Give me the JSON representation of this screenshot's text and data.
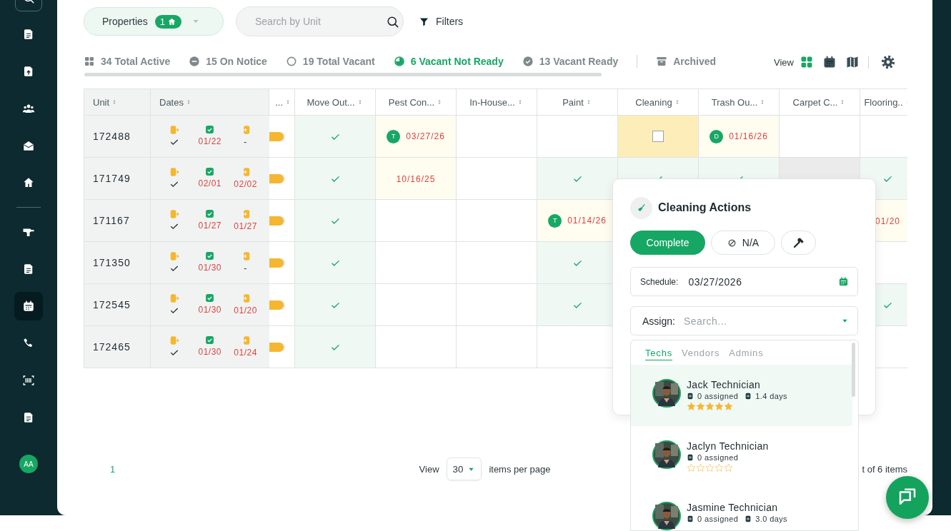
{
  "sidebar": {
    "sections": [
      {
        "items": [
          {
            "outlined": true,
            "selected": false
          },
          {
            "outlined": false,
            "selected": false
          },
          {
            "outlined": false,
            "selected": false
          },
          {
            "outlined": false,
            "selected": false
          },
          {
            "outlined": false,
            "selected": false
          },
          {
            "outlined": false,
            "selected": false
          }
        ]
      },
      {
        "items": [
          {
            "outlined": false,
            "selected": false
          },
          {
            "outlined": false,
            "selected": false
          },
          {
            "outlined": false,
            "selected": true
          },
          {
            "outlined": false,
            "selected": false
          },
          {
            "outlined": false,
            "selected": false
          },
          {
            "outlined": false,
            "selected": false
          }
        ]
      }
    ],
    "avatar": "AA"
  },
  "toolbar": {
    "properties_filter": {
      "label": "Properties",
      "count": "1"
    },
    "search": {
      "placeholder": "Search by Unit"
    },
    "filters_button": {
      "label": "Filters"
    }
  },
  "status_tabs": [
    {
      "label": "34 Total Active",
      "selected": false
    },
    {
      "label": "15 On Notice",
      "selected": false
    },
    {
      "label": "19 Total Vacant",
      "selected": false
    },
    {
      "label": "6 Vacant Not Ready",
      "selected": true
    },
    {
      "label": "13 Vacant Ready",
      "selected": false
    }
  ],
  "archive_tab": {
    "label": "Archived",
    "selected": false
  },
  "view_switch": {
    "label": "View",
    "options": [
      {
        "selected": true
      },
      {
        "selected": false
      },
      {
        "selected": false
      }
    ]
  },
  "table": {
    "columns": [
      {
        "label": "Unit"
      },
      {
        "label": "Dates"
      },
      {
        "label": "..."
      },
      {
        "label": "Move Out..."
      },
      {
        "label": "Pest Con..."
      },
      {
        "label": "In-House..."
      },
      {
        "label": "Paint"
      },
      {
        "label": "Cleaning"
      },
      {
        "label": "Trash Ou..."
      },
      {
        "label": "Carpet C..."
      },
      {
        "label": "Flooring.."
      }
    ],
    "rows": [
      {
        "cells": [
          {
            "kind": "unit",
            "text": "172488"
          },
          {
            "kind": "dates",
            "move_out_done": true,
            "due": "01/22",
            "move_in": "-"
          },
          {
            "kind": "pill"
          },
          {
            "kind": "check",
            "color": "#f0f8f4"
          },
          {
            "kind": "date",
            "badge": "T",
            "date": "03/27/26",
            "color": "#fffcf0"
          },
          {
            "kind": "empty"
          },
          {
            "kind": "empty"
          },
          {
            "kind": "checkbox",
            "checked": false,
            "color": "#fdedb9"
          },
          {
            "kind": "date",
            "badge": "D",
            "date": "01/16/26",
            "color": "#fffcf0"
          },
          {
            "kind": "empty"
          },
          {
            "kind": "empty"
          }
        ]
      },
      {
        "cells": [
          {
            "kind": "unit",
            "text": "171749"
          },
          {
            "kind": "dates",
            "move_out_done": true,
            "due": "02/01",
            "move_in": "02/02"
          },
          {
            "kind": "pill"
          },
          {
            "kind": "check",
            "color": "#f0f8f4"
          },
          {
            "kind": "date",
            "date": "10/16/25",
            "color": "#fffcf0"
          },
          {
            "kind": "empty"
          },
          {
            "kind": "check",
            "color": "#f0f8f4"
          },
          {
            "kind": "check",
            "color": "#f0f8f4"
          },
          {
            "kind": "check",
            "color": "#f0f8f4"
          },
          {
            "kind": "empty",
            "color": "#ebebeb"
          },
          {
            "kind": "check",
            "color": "#f0f8f4"
          }
        ]
      },
      {
        "cells": [
          {
            "kind": "unit",
            "text": "171167"
          },
          {
            "kind": "dates",
            "move_out_done": true,
            "due": "01/27",
            "move_in": "01/27"
          },
          {
            "kind": "pill"
          },
          {
            "kind": "check",
            "color": "#f0f8f4"
          },
          {
            "kind": "empty"
          },
          {
            "kind": "empty"
          },
          {
            "kind": "date",
            "badge": "T",
            "date": "01/14/26",
            "color": "#fffcf0"
          },
          {
            "kind": "empty"
          },
          {
            "kind": "empty"
          },
          {
            "kind": "empty"
          },
          {
            "kind": "date",
            "date": "01/20",
            "color": "#fffcf0"
          }
        ]
      },
      {
        "cells": [
          {
            "kind": "unit",
            "text": "171350"
          },
          {
            "kind": "dates",
            "move_out_done": true,
            "due": "01/30",
            "move_in": "-"
          },
          {
            "kind": "pill"
          },
          {
            "kind": "check",
            "color": "#f0f8f4"
          },
          {
            "kind": "empty"
          },
          {
            "kind": "empty"
          },
          {
            "kind": "check",
            "color": "#f0f8f4"
          },
          {
            "kind": "empty"
          },
          {
            "kind": "empty"
          },
          {
            "kind": "empty"
          },
          {
            "kind": "empty"
          }
        ]
      },
      {
        "cells": [
          {
            "kind": "unit",
            "text": "172545"
          },
          {
            "kind": "dates",
            "move_out_done": true,
            "due": "01/30",
            "move_in": "01/20"
          },
          {
            "kind": "pill"
          },
          {
            "kind": "check",
            "color": "#f0f8f4"
          },
          {
            "kind": "empty"
          },
          {
            "kind": "empty"
          },
          {
            "kind": "check",
            "color": "#f0f8f4"
          },
          {
            "kind": "empty"
          },
          {
            "kind": "empty"
          },
          {
            "kind": "empty"
          },
          {
            "kind": "check",
            "color": "#f0f8f4"
          }
        ]
      },
      {
        "cells": [
          {
            "kind": "unit",
            "text": "172465"
          },
          {
            "kind": "dates",
            "move_out_done": true,
            "due": "01/30",
            "move_in": "01/24"
          },
          {
            "kind": "pill"
          },
          {
            "kind": "check",
            "color": "#f0f8f4"
          },
          {
            "kind": "empty"
          },
          {
            "kind": "empty"
          },
          {
            "kind": "empty"
          },
          {
            "kind": "empty"
          },
          {
            "kind": "empty"
          },
          {
            "kind": "empty"
          },
          {
            "kind": "empty"
          }
        ]
      }
    ]
  },
  "footer": {
    "pages": [
      {
        "label": "1",
        "selected": true
      }
    ],
    "per_page_label": "View",
    "per_page": "30",
    "per_page_suffix": "items per page",
    "summary": "t of 6 items"
  },
  "popup": {
    "title": "Cleaning Actions",
    "buttons": [
      {
        "kind": "primary",
        "label": "Complete"
      },
      {
        "kind": "na",
        "label": "N/A"
      },
      {
        "kind": "tool"
      }
    ],
    "schedule": {
      "label": "Schedule:",
      "value": "03/27/2026"
    },
    "assign": {
      "label": "Assign:",
      "placeholder": "Search..."
    }
  },
  "assignee_dropdown": {
    "tabs": [
      {
        "label": "Techs",
        "selected": true
      },
      {
        "label": "Vendors",
        "selected": false
      },
      {
        "label": "Admins",
        "selected": false
      }
    ],
    "people": [
      {
        "name": "Jack Technician",
        "assigned": "0 assigned",
        "days": "1.4 days",
        "stars": 5,
        "selected": true
      },
      {
        "name": "Jaclyn Technician",
        "assigned": "0 assigned",
        "stars": 0,
        "selected": false
      },
      {
        "name": "Jasmine Technician",
        "assigned": "0 assigned",
        "days": "3.0 days",
        "selected": false
      }
    ]
  }
}
